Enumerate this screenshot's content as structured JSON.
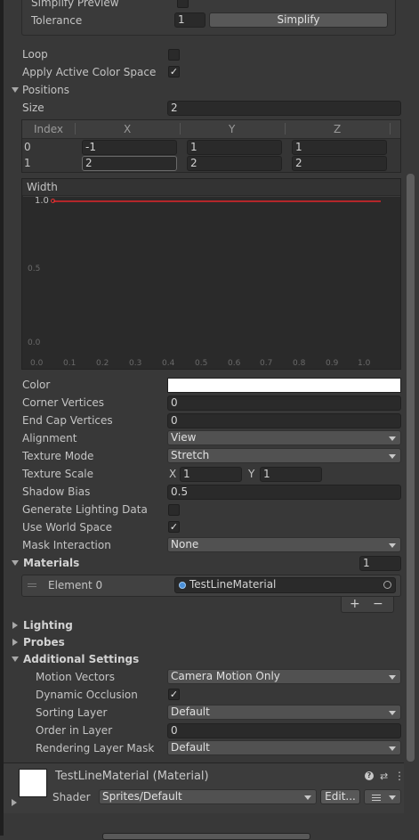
{
  "simplify": {
    "preview_label": "Simplify Preview",
    "tolerance_label": "Tolerance",
    "tolerance_value": "1",
    "simplify_button": "Simplify"
  },
  "loop_label": "Loop",
  "apply_color_space_label": "Apply Active Color Space",
  "positions": {
    "label": "Positions",
    "size_label": "Size",
    "size_value": "2",
    "headers": [
      "Index",
      "X",
      "Y",
      "Z"
    ],
    "rows": [
      {
        "index": "0",
        "x": "-1",
        "y": "1",
        "z": "1"
      },
      {
        "index": "1",
        "x": "2",
        "y": "2",
        "z": "2"
      }
    ]
  },
  "width_curve": {
    "label": "Width",
    "value_label": "1.0",
    "y_ticks": [
      "0.5",
      "0.0"
    ],
    "x_ticks": [
      "0.0",
      "0.1",
      "0.2",
      "0.3",
      "0.4",
      "0.5",
      "0.6",
      "0.7",
      "0.8",
      "0.9",
      "1.0"
    ],
    "curve_color": "#b3262a"
  },
  "props": {
    "color_label": "Color",
    "color_value": "#ffffff",
    "corner_vertices_label": "Corner Vertices",
    "corner_vertices_value": "0",
    "end_cap_vertices_label": "End Cap Vertices",
    "end_cap_vertices_value": "0",
    "alignment_label": "Alignment",
    "alignment_value": "View",
    "texture_mode_label": "Texture Mode",
    "texture_mode_value": "Stretch",
    "texture_scale_label": "Texture Scale",
    "texture_scale_x_label": "X",
    "texture_scale_x": "1",
    "texture_scale_y_label": "Y",
    "texture_scale_y": "1",
    "shadow_bias_label": "Shadow Bias",
    "shadow_bias_value": "0.5",
    "generate_lighting_label": "Generate Lighting Data",
    "use_world_space_label": "Use World Space",
    "mask_interaction_label": "Mask Interaction",
    "mask_interaction_value": "None"
  },
  "materials": {
    "label": "Materials",
    "count": "1",
    "element_label": "Element 0",
    "element_value": "TestLineMaterial",
    "add": "+",
    "remove": "−"
  },
  "sections": {
    "lighting": "Lighting",
    "probes": "Probes",
    "additional": "Additional Settings"
  },
  "additional": {
    "motion_vectors_label": "Motion Vectors",
    "motion_vectors_value": "Camera Motion Only",
    "dynamic_occlusion_label": "Dynamic Occlusion",
    "sorting_layer_label": "Sorting Layer",
    "sorting_layer_value": "Default",
    "order_in_layer_label": "Order in Layer",
    "order_in_layer_value": "0",
    "rendering_layer_mask_label": "Rendering Layer Mask",
    "rendering_layer_mask_value": "Default"
  },
  "material_footer": {
    "title": "TestLineMaterial (Material)",
    "shader_label": "Shader",
    "shader_value": "Sprites/Default",
    "edit_button": "Edit...",
    "checkmark": "✓"
  }
}
